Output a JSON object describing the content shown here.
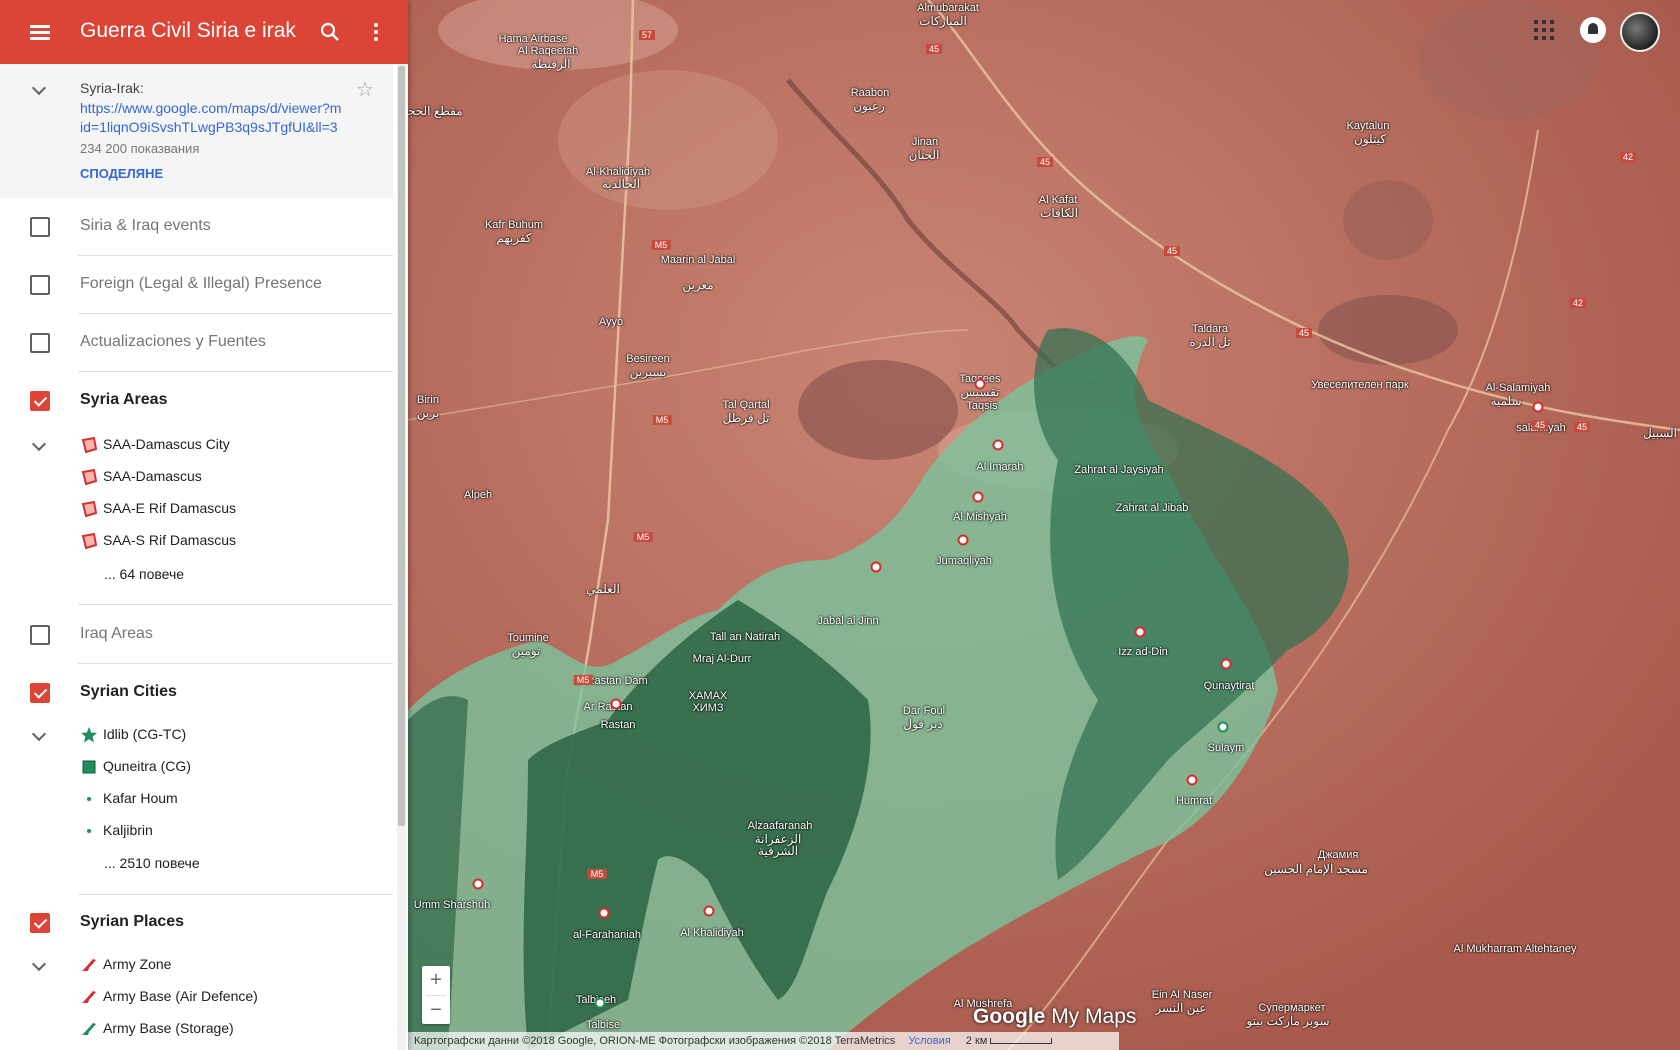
{
  "app": {
    "title": "Guerra Civil Siria e irak"
  },
  "info": {
    "name": "Syria-Irak:",
    "url": "https://www.google.com/maps/d/viewer?mid=1liqnO9iSvshTLwgPB3q9sJTgfUI&ll=3",
    "views": "234 200 показвания",
    "share": "СПОДЕЛЯНЕ"
  },
  "layers": [
    {
      "name": "Siria & Iraq events",
      "checked": false
    },
    {
      "name": "Foreign (Legal & Illegal) Presence",
      "checked": false
    },
    {
      "name": "Actualizaciones y Fuentes",
      "checked": false
    },
    {
      "name": "Syria Areas",
      "checked": true,
      "items": [
        "SAA-Damascus City",
        "SAA-Damascus",
        "SAA-E Rif Damascus",
        "SAA-S Rif Damascus"
      ],
      "more": "... 64 повече"
    },
    {
      "name": "Iraq Areas",
      "checked": false
    },
    {
      "name": "Syrian Cities",
      "checked": true,
      "items": [
        "Idlib (CG-TC)",
        "Quneitra (CG)",
        "Kafar Houm",
        "Kaljibrin"
      ],
      "more": "... 2510 повече"
    },
    {
      "name": "Syrian Places",
      "checked": true,
      "items": [
        "Army Zone",
        "Army Base (Air Defence)",
        "Army Base (Storage)"
      ]
    }
  ],
  "map": {
    "labels": [
      "Hama Airbase",
      "Al Raqeetah",
      "الرقيطة",
      "Almubarakat",
      "المباركات",
      "Raabon",
      "رعبون",
      "Jinan",
      "الجنان",
      "Kaytalun",
      "كيتلون",
      "Al Kafat",
      "الكافات",
      "Al-Khalidiyah",
      "الخالدية",
      "Kafr Buhum",
      "كفربهم",
      "Maarin al Jabal",
      "معرين",
      "Ayyo",
      "Besireen",
      "بسيرين",
      "Taldara",
      "تل الدرة",
      "Birin",
      "برين",
      "Tal Qartal",
      "تل قرطل",
      "Taqsees",
      "تقسيس",
      "Taqsis",
      "Увеселителен парк",
      "Al-Salamiyah",
      "سلمية",
      "salamiyah",
      "Al Imarah",
      "Zahrat al Jaysiyah",
      "Zahrat al Jibab",
      "Al Mishyah",
      "Jumaqliyah",
      "Alpeh",
      "Jabal al Jinn",
      "Tall an Natirah",
      "Mraj Al-Durr",
      "Toumine",
      "تومين",
      "al-Rastan Dam",
      "Ar Rastan",
      "Rastan",
      "Izz ad-Din",
      "Qunaytirat",
      "Dar Foul",
      "دير فول",
      "Sulaym",
      "Humrat",
      "Джамия",
      "مسجد الإمام الحسين",
      "Alzaafaranah",
      "الزعفرانة",
      "الشرقية",
      "Umm Sharshuh",
      "al-Farahaniah",
      "Al Khalidiyah",
      "Al Mukharram Altehtaney",
      "Ein Al Naser",
      "عين النسر",
      "Al Mushrefa",
      "Супермаркет",
      "سوبر ماركت بيتو",
      "Talbise",
      "Talbiseh",
      "XAMAX",
      "ХИМЗ",
      "مقطع الحجر",
      "العلمي",
      "السبيل"
    ],
    "logo_text": "Google",
    "logo_suffix": "My Maps",
    "zoom_in": "+",
    "zoom_out": "−",
    "attribution": "Картографски данни ©2018 Google, ORION-ME Фотографски изображения ©2018 TerraMetrics",
    "terms": "Условия",
    "scale": "2 км",
    "roads": [
      "57",
      "45",
      "45",
      "45",
      "45",
      "45",
      "45",
      "42",
      "42",
      "M5",
      "M5",
      "M5",
      "M5",
      "M5"
    ]
  },
  "colors": {
    "accent": "#db4437",
    "link": "#3367d6",
    "area_light": "#6fbf94",
    "area_dark": "#1e5f3d"
  }
}
